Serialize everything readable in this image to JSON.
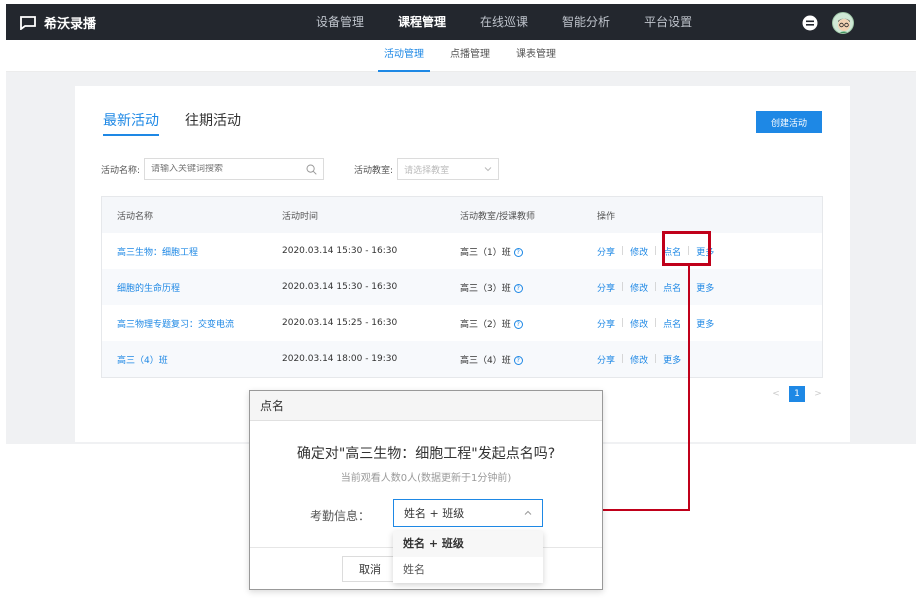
{
  "app": {
    "name": "希沃录播"
  },
  "nav": {
    "items": [
      {
        "label": "设备管理",
        "active": false
      },
      {
        "label": "课程管理",
        "active": true
      },
      {
        "label": "在线巡课",
        "active": false
      },
      {
        "label": "智能分析",
        "active": false
      },
      {
        "label": "平台设置",
        "active": false
      }
    ]
  },
  "subnav": {
    "items": [
      {
        "label": "活动管理",
        "active": true
      },
      {
        "label": "点播管理",
        "active": false
      },
      {
        "label": "课表管理",
        "active": false
      }
    ]
  },
  "tabs": [
    {
      "label": "最新活动",
      "active": true
    },
    {
      "label": "往期活动",
      "active": false
    }
  ],
  "create_button": "创建活动",
  "filters": {
    "name_label": "活动名称:",
    "name_placeholder": "请输入关键词搜索",
    "room_label": "活动教室:",
    "room_placeholder": "请选择教室"
  },
  "table": {
    "headers": [
      "活动名称",
      "活动时间",
      "活动教室/授课教师",
      "操作"
    ],
    "rows": [
      {
        "name": "高三生物：细胞工程",
        "time": "2020.03.14 15:30 - 16:30",
        "room": "高三（1）班",
        "actions": [
          "分享",
          "修改",
          "点名",
          "更多"
        ]
      },
      {
        "name": "细胞的生命历程",
        "time": "2020.03.14 15:30 - 16:30",
        "room": "高三（3）班",
        "actions": [
          "分享",
          "修改",
          "点名",
          "更多"
        ]
      },
      {
        "name": "高三物理专题复习：交变电流",
        "time": "2020.03.14 15:25 - 16:30",
        "room": "高三（2）班",
        "actions": [
          "分享",
          "修改",
          "点名",
          "更多"
        ]
      },
      {
        "name": "高三（4）班",
        "time": "2020.03.14 18:00 - 19:30",
        "room": "高三（4）班",
        "actions": [
          "分享",
          "修改",
          "更多"
        ]
      }
    ]
  },
  "pagination": {
    "current": "1",
    "prev": "<",
    "next": ">"
  },
  "dialog": {
    "title": "点名",
    "question": "确定对\"高三生物：细胞工程\"发起点名吗?",
    "subtitle": "当前观看人数0人(数据更新于1分钟前)",
    "attendance_label": "考勤信息：",
    "selected": "姓名 + 班级",
    "options": [
      "姓名 + 班级",
      "姓名"
    ],
    "cancel": "取消"
  },
  "colors": {
    "accent": "#1e88e5",
    "highlight": "#c0001a",
    "topbar": "#23272e"
  }
}
